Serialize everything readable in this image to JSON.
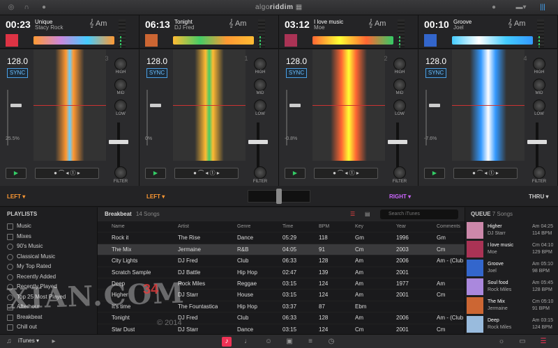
{
  "app": {
    "logo_a": "algo",
    "logo_b": "riddim"
  },
  "decks": [
    {
      "time": "00:23",
      "title": "Unique",
      "artist": "Stacy Rock",
      "key": "Am",
      "bpm": "128.0",
      "sync": "SYNC",
      "pct": "25.5%",
      "num": "3",
      "art": "#d34",
      "ovw": "#f93"
    },
    {
      "time": "06:13",
      "title": "Tonight",
      "artist": "DJ Fred",
      "key": "Am",
      "bpm": "128.0",
      "sync": "SYNC",
      "pct": "0%",
      "num": "1",
      "art": "#c63",
      "ovw": "#fb3"
    },
    {
      "time": "03:12",
      "title": "I love music",
      "artist": "Moe",
      "key": "Am",
      "bpm": "128.0",
      "sync": "SYNC",
      "pct": "-0.8%",
      "num": "2",
      "art": "#a35",
      "ovw": "#f63"
    },
    {
      "time": "00:10",
      "title": "Groove",
      "artist": "Joel",
      "key": "Am",
      "bpm": "128.0",
      "sync": "SYNC",
      "pct": "-7.6%",
      "num": "4",
      "art": "#36c",
      "ovw": "#4cf"
    }
  ],
  "eq": {
    "high": "HIGH",
    "mid": "MID",
    "low": "LOW",
    "filter": "FILTER"
  },
  "xrow": {
    "l1": "LEFT",
    "l2": "LEFT",
    "r1": "RIGHT",
    "r2": "THRU"
  },
  "playlists": {
    "header": "PLAYLISTS",
    "items": [
      "Music",
      "Mixes",
      "90's Music",
      "Classical Music",
      "My Top Rated",
      "Recently Added",
      "Recently Played",
      "Top 25 Most Played",
      "Afterhour",
      "Breakbeat",
      "Chill out"
    ]
  },
  "library": {
    "name": "Breakbeat",
    "count": "14 Songs",
    "search": "Search iTunes",
    "columns": [
      "Name",
      "Artist",
      "Genre",
      "Time",
      "BPM",
      "Key",
      "Year",
      "Comments"
    ],
    "rows": [
      [
        "Rock it",
        "The Rise",
        "Dance",
        "05:29",
        "118",
        "Gm",
        "1996",
        "Gm"
      ],
      [
        "The Mix",
        "Jermaine",
        "R&B",
        "04:05",
        "91",
        "Cm",
        "2003",
        "Cm"
      ],
      [
        "City Lights",
        "DJ Fred",
        "Club",
        "06:33",
        "128",
        "Am",
        "2006",
        "Am - (Club Mix)"
      ],
      [
        "Scratch Sample",
        "DJ Battle",
        "Hip Hop",
        "02:47",
        "139",
        "Am",
        "2001",
        ""
      ],
      [
        "Deep",
        "Rock Miles",
        "Reggae",
        "03:15",
        "124",
        "Am",
        "1977",
        "Am"
      ],
      [
        "Higher",
        "DJ Starr",
        "House",
        "03:15",
        "124",
        "Am",
        "2001",
        "Cm"
      ],
      [
        "It's time",
        "The Fountastica",
        "Hip Hop",
        "03:37",
        "87",
        "Ebm",
        "",
        ""
      ],
      [
        "Tonight",
        "DJ Fred",
        "Club",
        "06:33",
        "128",
        "Am",
        "2006",
        "Am - (Club Mix)"
      ],
      [
        "Star Dust",
        "DJ Starr",
        "Dance",
        "03:15",
        "124",
        "Cm",
        "2001",
        "Cm"
      ]
    ]
  },
  "queue": {
    "header": "QUEUE",
    "count": "7 Songs",
    "items": [
      {
        "title": "Higher",
        "artist": "DJ Starr",
        "key": "Am 04:25",
        "bpm": "114 BPM",
        "color": "#c8a"
      },
      {
        "title": "I love music",
        "artist": "Moe",
        "key": "Cm 04:10",
        "bpm": "129 BPM",
        "color": "#a35"
      },
      {
        "title": "Groove",
        "artist": "Joel",
        "key": "Am 05:10",
        "bpm": "98 BPM",
        "color": "#36c"
      },
      {
        "title": "Soul food",
        "artist": "Rock Miles",
        "key": "Am 05:45",
        "bpm": "128 BPM",
        "color": "#a8d"
      },
      {
        "title": "The Mix",
        "artist": "Jermaine",
        "key": "Cm 05:10",
        "bpm": "91 BPM",
        "color": "#c63"
      },
      {
        "title": "Deep",
        "artist": "Rock Miles",
        "key": "Am 03:15",
        "bpm": "124 BPM",
        "color": "#9bd"
      }
    ]
  },
  "bottom": {
    "source": "iTunes"
  },
  "watermark": {
    "text": "XIAN.COM",
    "num": "34",
    "copy": "© 2014"
  }
}
